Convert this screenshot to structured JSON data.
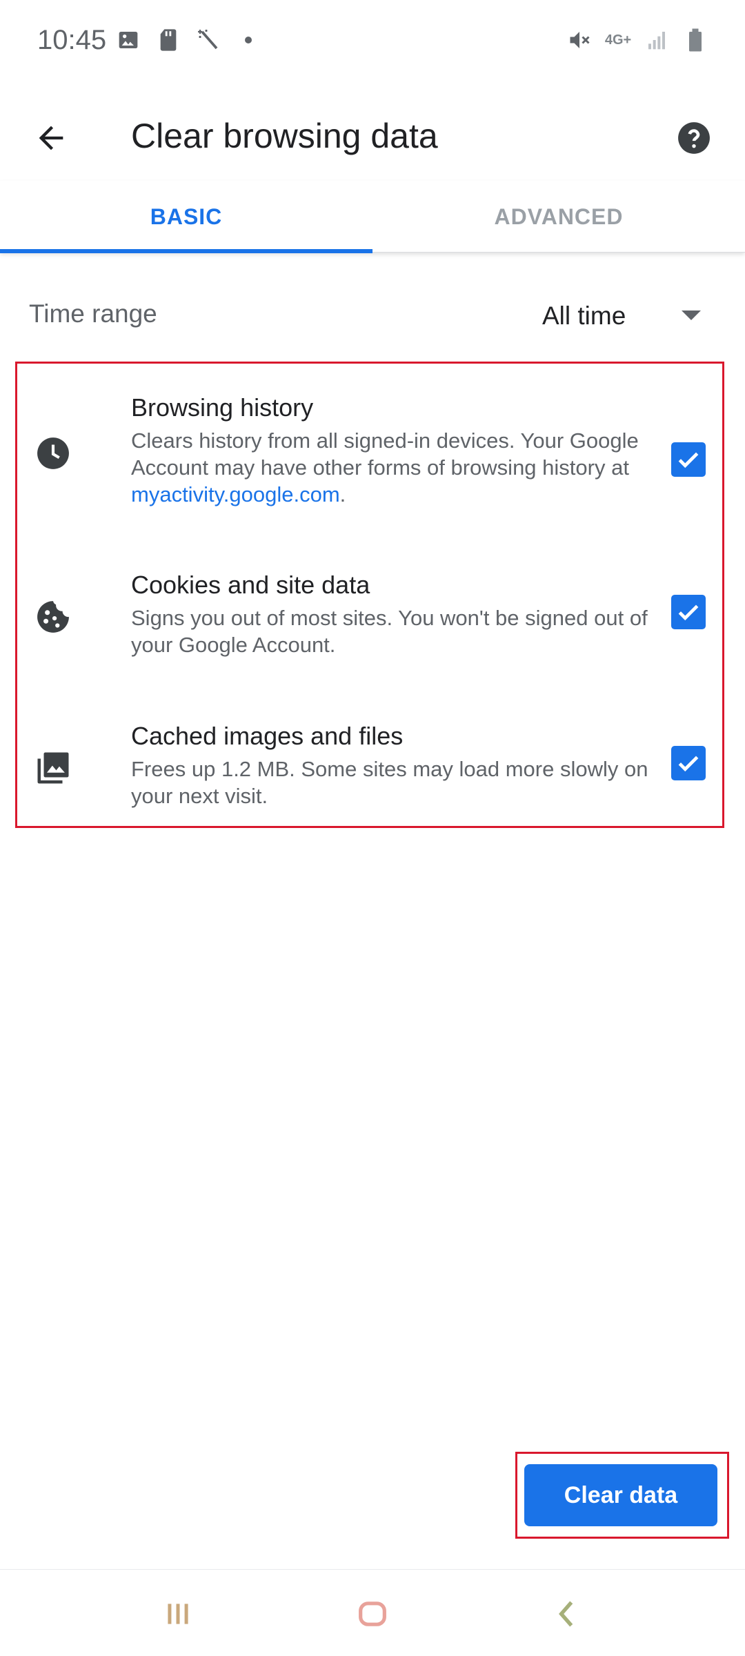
{
  "status_bar": {
    "time": "10:45",
    "network": "4G+",
    "left_icons": [
      "image-icon",
      "sd-card-icon",
      "magic-wand-icon",
      "dot-icon"
    ],
    "right_icons": [
      "mute-icon",
      "network-4g-icon",
      "signal-icon",
      "battery-icon"
    ]
  },
  "app_bar": {
    "title": "Clear browsing data",
    "back_icon": "arrow-back-icon",
    "help_icon": "help-icon"
  },
  "tabs": [
    {
      "label": "BASIC",
      "selected": true
    },
    {
      "label": "ADVANCED",
      "selected": false
    }
  ],
  "time_range": {
    "label": "Time range",
    "value": "All time"
  },
  "options": [
    {
      "icon": "clock-icon",
      "title": "Browsing history",
      "description": "Clears history from all signed-in devices. Your Google Account may have other forms of browsing history at ",
      "link": "myactivity.google.com",
      "suffix": ".",
      "checked": true
    },
    {
      "icon": "cookie-icon",
      "title": "Cookies and site data",
      "description": "Signs you out of most sites. You won't be signed out of your Google Account.",
      "checked": true
    },
    {
      "icon": "photo-library-icon",
      "title": "Cached images and files",
      "description": "Frees up 1.2 MB. Some sites may load more slowly on your next visit.",
      "checked": true
    }
  ],
  "clear_button": {
    "label": "Clear data"
  },
  "colors": {
    "accent": "#1a73e8",
    "highlight_border": "#d9182d",
    "nav_recents": "#c9a87c",
    "nav_home": "#e8a29a",
    "nav_back": "#a6b07a"
  },
  "nav_bar": [
    "recents-icon",
    "home-icon",
    "back-icon"
  ]
}
